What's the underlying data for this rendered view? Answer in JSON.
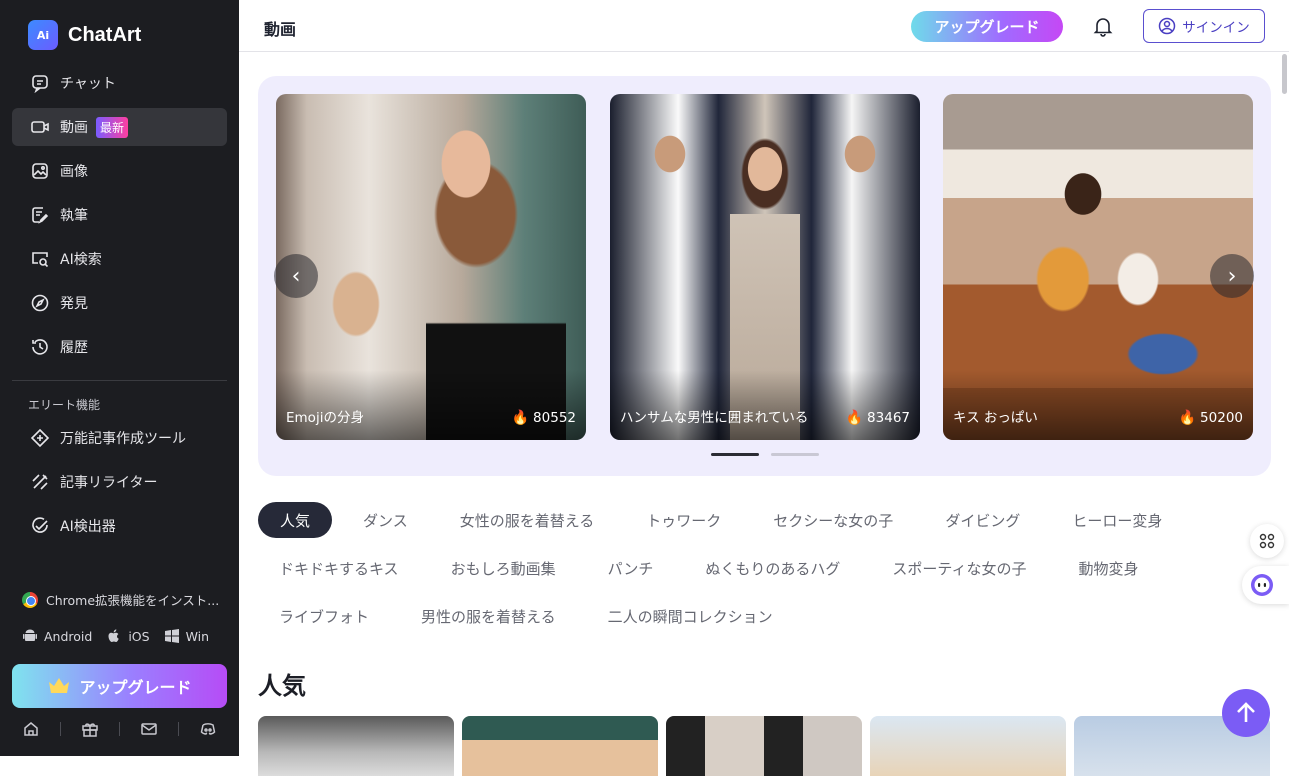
{
  "app": {
    "name": "ChatArt",
    "logo_mark": "Ai"
  },
  "sidebar": {
    "items": [
      {
        "label": "チャット",
        "icon": "chat-icon"
      },
      {
        "label": "動画",
        "icon": "video-icon",
        "badge": "最新",
        "active": true
      },
      {
        "label": "画像",
        "icon": "image-icon"
      },
      {
        "label": "執筆",
        "icon": "write-icon"
      },
      {
        "label": "AI検索",
        "icon": "ai-search-icon"
      },
      {
        "label": "発見",
        "icon": "compass-icon"
      },
      {
        "label": "履歴",
        "icon": "history-icon"
      }
    ],
    "elite_heading": "エリート機能",
    "elite_items": [
      {
        "label": "万能記事作成ツール",
        "icon": "article-icon"
      },
      {
        "label": "記事リライター",
        "icon": "rewrite-icon"
      },
      {
        "label": "AI検出器",
        "icon": "detector-icon"
      }
    ],
    "chrome_ext": "Chrome拡張機能をインスト...",
    "platforms": [
      "Android",
      "iOS",
      "Win"
    ],
    "upgrade_label": "アップグレード"
  },
  "header": {
    "title": "動画",
    "upgrade_label": "アップグレード",
    "signin_label": "サインイン"
  },
  "carousel": {
    "cards": [
      {
        "title": "Emojiの分身",
        "count": "80552"
      },
      {
        "title": "ハンサムな男性に囲まれている",
        "count": "83467"
      },
      {
        "title": "キス おっぱい",
        "count": "50200"
      }
    ],
    "prev_symbol": "‹",
    "next_symbol": "›"
  },
  "tags": {
    "rows": [
      [
        "人気",
        "ダンス",
        "女性の服を着替える",
        "トゥワーク",
        "セクシーな女の子",
        "ダイビング",
        "ヒーロー変身"
      ],
      [
        "ドキドキするキス",
        "おもしろ動画集",
        "パンチ",
        "ぬくもりのあるハグ",
        "スポーティな女の子",
        "動物変身"
      ],
      [
        "ライブフォト",
        "男性の服を着替える",
        "二人の瞬間コレクション"
      ]
    ],
    "active": "人気"
  },
  "section": {
    "title": "人気"
  },
  "colors": {
    "accent": "#7b5cf5",
    "sidebar_bg": "#1c1d21",
    "active_tag": "#262938"
  }
}
